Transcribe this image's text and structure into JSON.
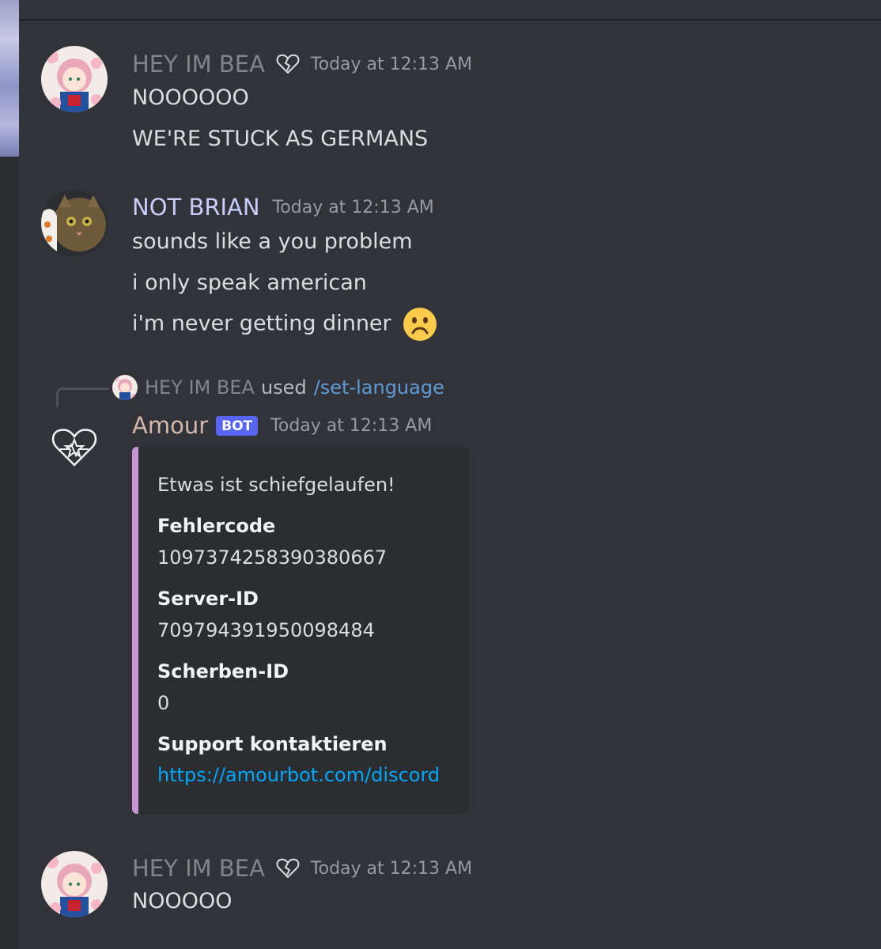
{
  "messages": [
    {
      "username": "HEY IM BEA",
      "username_color": "#80848e",
      "timestamp": "Today at 12:13 AM",
      "badge_icon": "broken-heart-icon",
      "lines": [
        "NOOOOOO",
        "WE'RE STUCK AS GERMANS"
      ]
    },
    {
      "username": "NOT BRIAN",
      "username_color": "#c9cdfb",
      "timestamp": "Today at 12:13 AM",
      "lines": [
        "sounds like a you problem",
        "i only speak american",
        "i'm never getting dinner"
      ],
      "emoji": "frowning-face-emoji"
    },
    {
      "reply": {
        "username": "HEY IM BEA",
        "used_text": "used",
        "command": "/set-language"
      },
      "username": "Amour",
      "username_color": "#d5b8ad",
      "bot_tag": "BOT",
      "timestamp": "Today at 12:13 AM",
      "avatar_icon": "heart-star-icon",
      "embed": {
        "accent_color": "#c795d1",
        "description": "Etwas ist schiefgelaufen!",
        "fields": [
          {
            "name": "Fehlercode",
            "value": "1097374258390380667"
          },
          {
            "name": "Server-ID",
            "value": "709794391950098484"
          },
          {
            "name": "Scherben-ID",
            "value": "0"
          },
          {
            "name": "Support kontaktieren",
            "value": "https://amourbot.com/discord"
          }
        ]
      }
    },
    {
      "username": "HEY IM BEA",
      "username_color": "#80848e",
      "timestamp": "Today at 12:13 AM",
      "badge_icon": "broken-heart-icon",
      "lines": [
        "NOOOOO"
      ]
    }
  ]
}
